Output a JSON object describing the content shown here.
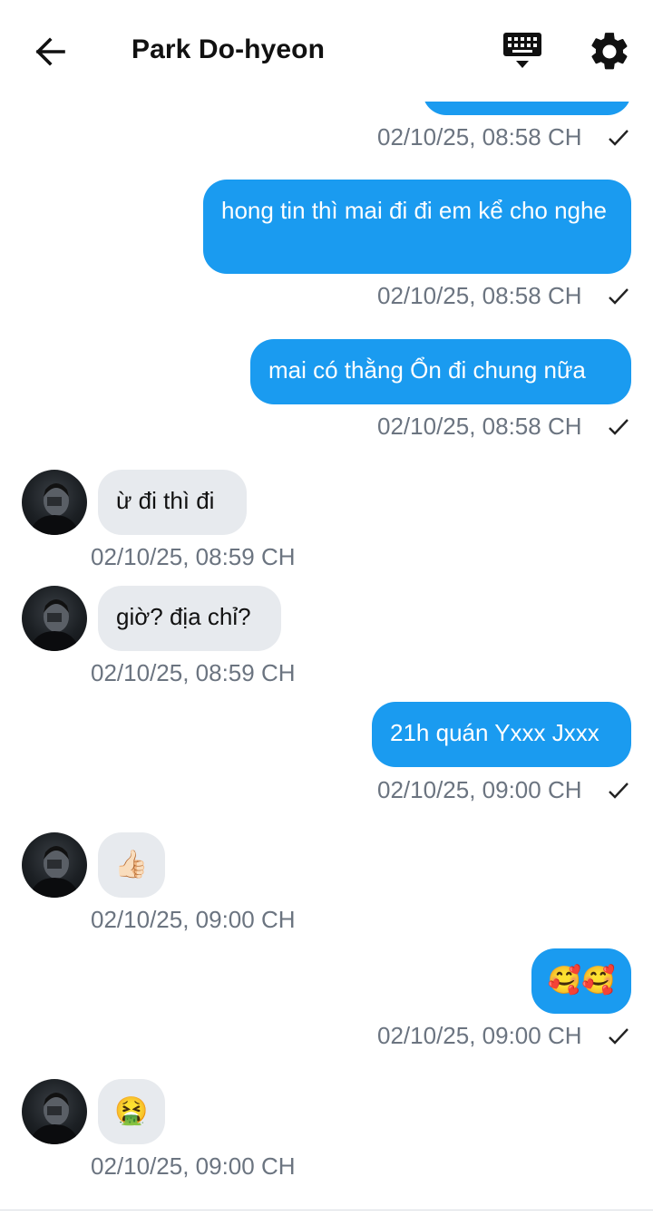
{
  "header": {
    "title": "Park Do-hyeon",
    "back_icon": "arrow-left-icon",
    "keyboard_icon": "keyboard-icon",
    "settings_icon": "gear-icon"
  },
  "colors": {
    "outgoing_bubble": "#1a9bf0",
    "incoming_bubble": "#e7eaee",
    "timestamp": "#6b7480"
  },
  "messages": [
    {
      "direction": "out",
      "text": "",
      "timestamp": "02/10/25, 08:58 CH",
      "status": "sent-check"
    },
    {
      "direction": "out",
      "text": "hong tin thì mai đi đi em kể cho nghe",
      "timestamp": "02/10/25, 08:58 CH",
      "status": "sent-check"
    },
    {
      "direction": "out",
      "text": "mai có thằng Ổn đi chung nữa",
      "timestamp": "02/10/25, 08:58 CH",
      "status": "sent-check"
    },
    {
      "direction": "in",
      "text": "ừ đi thì đi",
      "timestamp": "02/10/25, 08:59 CH"
    },
    {
      "direction": "in",
      "text": "giờ? địa chỉ?",
      "timestamp": "02/10/25, 08:59 CH"
    },
    {
      "direction": "out",
      "text": "21h quán Yxxx Jxxx",
      "timestamp": "02/10/25, 09:00 CH",
      "status": "sent-check"
    },
    {
      "direction": "in",
      "text": "👍🏻",
      "timestamp": "02/10/25, 09:00 CH"
    },
    {
      "direction": "out",
      "text": "🥰🥰",
      "timestamp": "02/10/25, 09:00 CH",
      "status": "sent-check"
    },
    {
      "direction": "in",
      "text": "🤮",
      "timestamp": "02/10/25, 09:00 CH"
    }
  ]
}
